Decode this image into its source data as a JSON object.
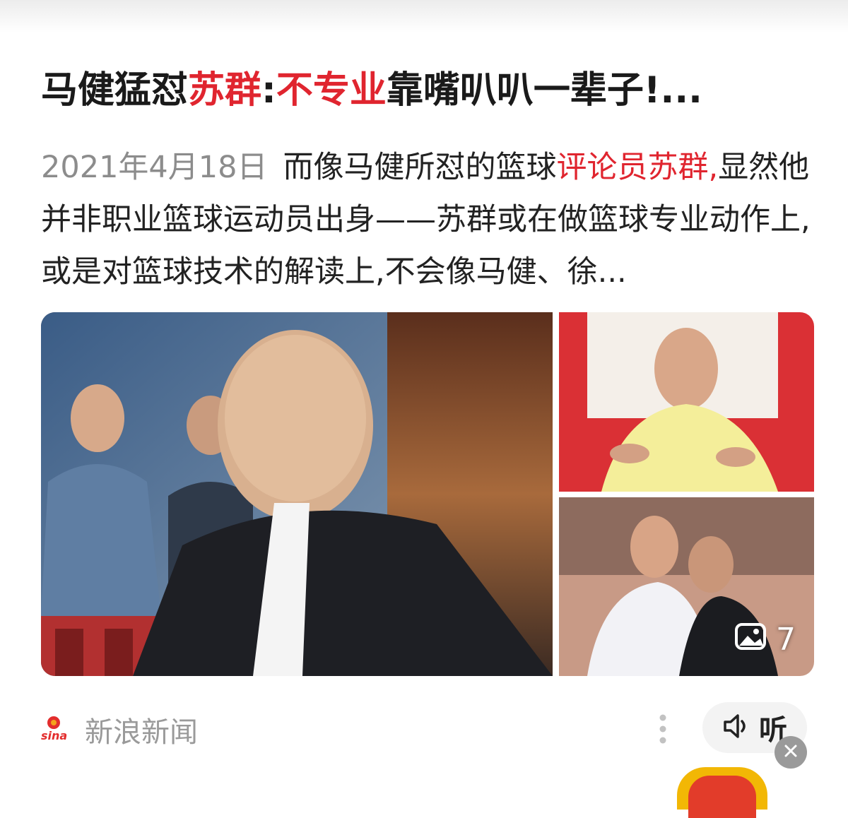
{
  "article": {
    "title_parts": [
      "马健猛怼",
      "苏群",
      ":",
      "不专业",
      "靠嘴叭叭一辈子!..."
    ],
    "date": "2021年4月18日",
    "summary_before": "而像马健所怼的篮球",
    "summary_highlight": "评论员苏群,",
    "summary_after": "显然他并非职业篮球运动员出身——苏群或在做篮球专业动作上,或是对篮球技术的解读上,不会像马健、徐...",
    "image_count": "7"
  },
  "source": {
    "name": "新浪新闻",
    "logo_text": "sina"
  },
  "actions": {
    "listen_label": "听"
  },
  "colors": {
    "highlight": "#e0252f",
    "text": "#1a1a1a",
    "muted": "#8c8c8c"
  },
  "icons": [
    "image-gallery-icon",
    "more-vertical-icon",
    "speaker-icon",
    "close-icon"
  ]
}
